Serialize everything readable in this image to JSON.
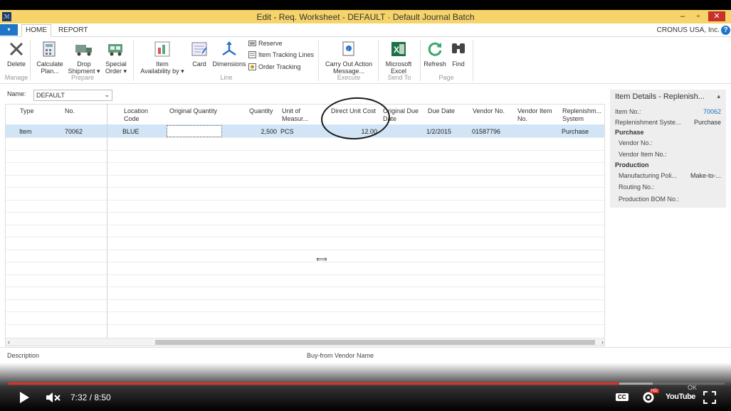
{
  "window": {
    "title": "Edit - Req. Worksheet - DEFAULT · Default Journal Batch",
    "minimize": "–",
    "restore": "▫",
    "close": "✕"
  },
  "tabs": [
    {
      "label": "HOME"
    },
    {
      "label": "REPORT"
    }
  ],
  "company": "CRONUS USA, Inc.",
  "help": "?",
  "ribbon": {
    "manage": {
      "group": "Manage",
      "delete": "Delete"
    },
    "prepare": {
      "group": "Prepare",
      "calc1": "Calculate",
      "calc2": "Plan...",
      "drop1": "Drop",
      "drop2": "Shipment ▾",
      "special1": "Special",
      "special2": "Order ▾"
    },
    "line": {
      "group": "Line",
      "avail1": "Item",
      "avail2": "Availability by ▾",
      "card": "Card",
      "dimensions": "Dimensions",
      "reserve": "Reserve",
      "tracking": "Item Tracking Lines",
      "ordertracking": "Order Tracking"
    },
    "execute": {
      "group": "Execute",
      "carry1": "Carry Out Action",
      "carry2": "Message..."
    },
    "sendto": {
      "group": "Send To",
      "excel1": "Microsoft",
      "excel2": "Excel"
    },
    "page": {
      "group": "Page",
      "refresh": "Refresh",
      "find": "Find"
    }
  },
  "name_field": {
    "label": "Name:",
    "value": "DEFAULT"
  },
  "grid": {
    "columns": [
      {
        "l1": "Type",
        "l2": ""
      },
      {
        "l1": "No.",
        "l2": ""
      },
      {
        "l1": "Location",
        "l2": "Code"
      },
      {
        "l1": "Original Quantity",
        "l2": ""
      },
      {
        "l1": "Quantity",
        "l2": ""
      },
      {
        "l1": "Unit of",
        "l2": "Measur..."
      },
      {
        "l1": "Direct Unit Cost",
        "l2": ""
      },
      {
        "l1": "Original Due",
        "l2": "Date"
      },
      {
        "l1": "Due Date",
        "l2": ""
      },
      {
        "l1": "Vendor No.",
        "l2": ""
      },
      {
        "l1": "Vendor Item",
        "l2": "No."
      },
      {
        "l1": "Replenishm...",
        "l2": "System"
      }
    ],
    "row": {
      "type": "Item",
      "no": "70062",
      "location": "BLUE",
      "original_quantity": "",
      "quantity": "2,500",
      "uom": "PCS",
      "direct_unit_cost": "12.00",
      "original_due_date": "",
      "due_date": "1/2/2015",
      "vendor_no": "01587796",
      "vendor_item_no": "",
      "replenishment": "Purchase"
    }
  },
  "factbox": {
    "title": "Item Details - Replenish...",
    "collapse": "▴",
    "item_no_label": "Item No.:",
    "item_no_value": "70062",
    "repl_label": "Replenishment Syste...",
    "repl_value": "Purchase",
    "purchase_section": "Purchase",
    "vendor_no_label": "Vendor No.:",
    "vendor_item_no_label": "Vendor Item No.:",
    "production_section": "Production",
    "mfg_policy_label": "Manufacturing Poli...",
    "mfg_policy_value": "Make-to-...",
    "routing_label": "Routing No.:",
    "bom_label": "Production BOM No.:"
  },
  "bottom": {
    "description": "Description",
    "vendor_name": "Buy-from Vendor Name"
  },
  "player": {
    "time": "7:32 / 8:50",
    "progress_fraction": 0.8528,
    "buffer_fraction": 0.9,
    "ok": "OK",
    "cc": "CC",
    "hd": "HD",
    "youtube": "YouTube",
    "play_icon": "play-icon",
    "mute_icon": "mute-icon",
    "fullscreen_icon": "fullscreen-icon"
  }
}
